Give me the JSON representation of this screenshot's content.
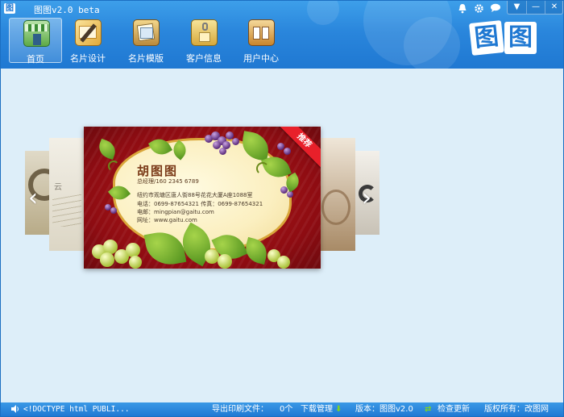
{
  "window": {
    "title": "图图v2.0 beta",
    "logo_glyph": "图"
  },
  "system_buttons": {
    "bell_icon": "bell-icon",
    "settings_icon": "gear-icon",
    "message_icon": "chat-icon",
    "menu_glyph": "▼",
    "minimize_glyph": "—",
    "close_glyph": "✕"
  },
  "toolbar": {
    "items": [
      {
        "label": "首页",
        "icon": "storefront-icon",
        "active": true
      },
      {
        "label": "名片设计",
        "icon": "card-design-icon",
        "active": false
      },
      {
        "label": "名片模版",
        "icon": "template-icon",
        "active": false
      },
      {
        "label": "客户信息",
        "icon": "client-file-icon",
        "active": false
      },
      {
        "label": "用户中心",
        "icon": "user-center-icon",
        "active": false
      }
    ]
  },
  "brand": {
    "logo_text": "图图"
  },
  "carousel": {
    "prev_glyph": "‹",
    "next_glyph": "›",
    "featured_card": {
      "ribbon": "推荐",
      "name": "胡图图",
      "title": "总经理/160 2345 6789",
      "address": "纽约市观塘区唐人街88号花花大厦A座1088室",
      "phone": "电话：0699-87654321  传真：0699-87654321",
      "email": "电邮：mingpian@gaitu.com",
      "website": "网址：www.gaitu.com"
    }
  },
  "statusbar": {
    "status_text": "<!DOCTYPE html PUBLI...",
    "export_label": "导出印刷文件：",
    "export_count": "0个",
    "download_label": "下载管理",
    "download_glyph": "⬇",
    "version": "版本：图图v2.0",
    "update_glyph": "⇄",
    "update_label": "检查更新",
    "copyright": "版权所有：改图网"
  },
  "colors": {
    "accent": "#1f78d2",
    "card_red": "#b01818",
    "ribbon": "#e8202a",
    "content_bg": "#ddeef9"
  }
}
